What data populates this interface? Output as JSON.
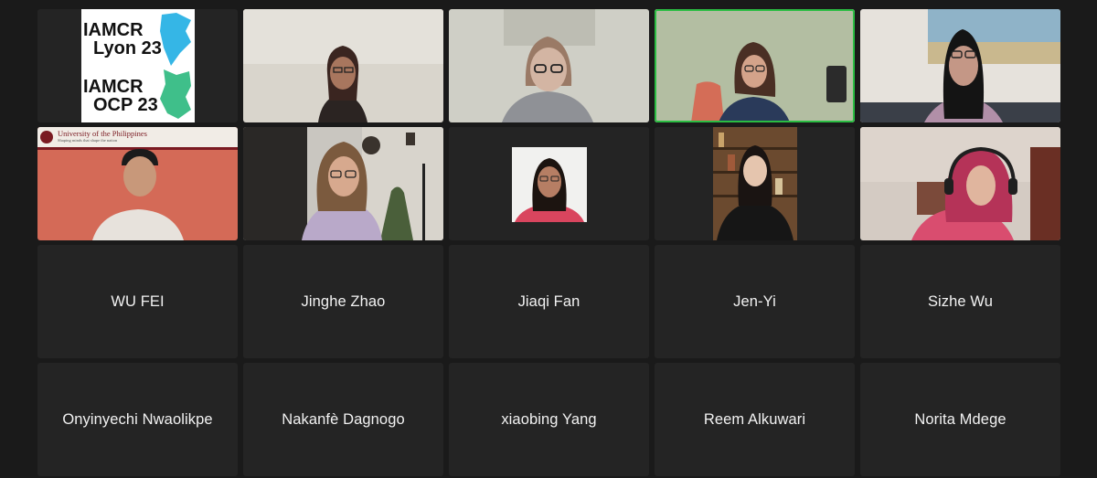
{
  "meeting": {
    "logo_text": [
      "IAMCR",
      "Lyon 23",
      "IAMCR",
      "OCP 23"
    ],
    "video_tiles": [
      {
        "id": "logo",
        "type": "logo"
      },
      {
        "id": "p2",
        "type": "video"
      },
      {
        "id": "p3",
        "type": "video"
      },
      {
        "id": "p4",
        "type": "video",
        "speaking": true
      },
      {
        "id": "p5",
        "type": "video"
      },
      {
        "id": "p6",
        "type": "video",
        "banner_text": [
          "University of the Philippines",
          "Shaping minds that shape the nation"
        ]
      },
      {
        "id": "p7",
        "type": "video"
      },
      {
        "id": "p8",
        "type": "video"
      },
      {
        "id": "p9",
        "type": "video"
      },
      {
        "id": "p10",
        "type": "video"
      }
    ],
    "name_tiles": [
      "WU FEI",
      "Jinghe Zhao",
      "Jiaqi Fan",
      "Jen-Yi",
      "Sizhe Wu",
      "Onyinyechi Nwaolikpe",
      "Nakanfè Dagnogo",
      "xiaobing Yang",
      "Reem Alkuwari",
      "Norita Mdege"
    ]
  },
  "colors": {
    "background": "#1a1a1a",
    "tile": "#242424",
    "speaking_border": "#2bbd43",
    "logo_blue": "#35b6e6",
    "logo_green": "#3fbf8a"
  }
}
